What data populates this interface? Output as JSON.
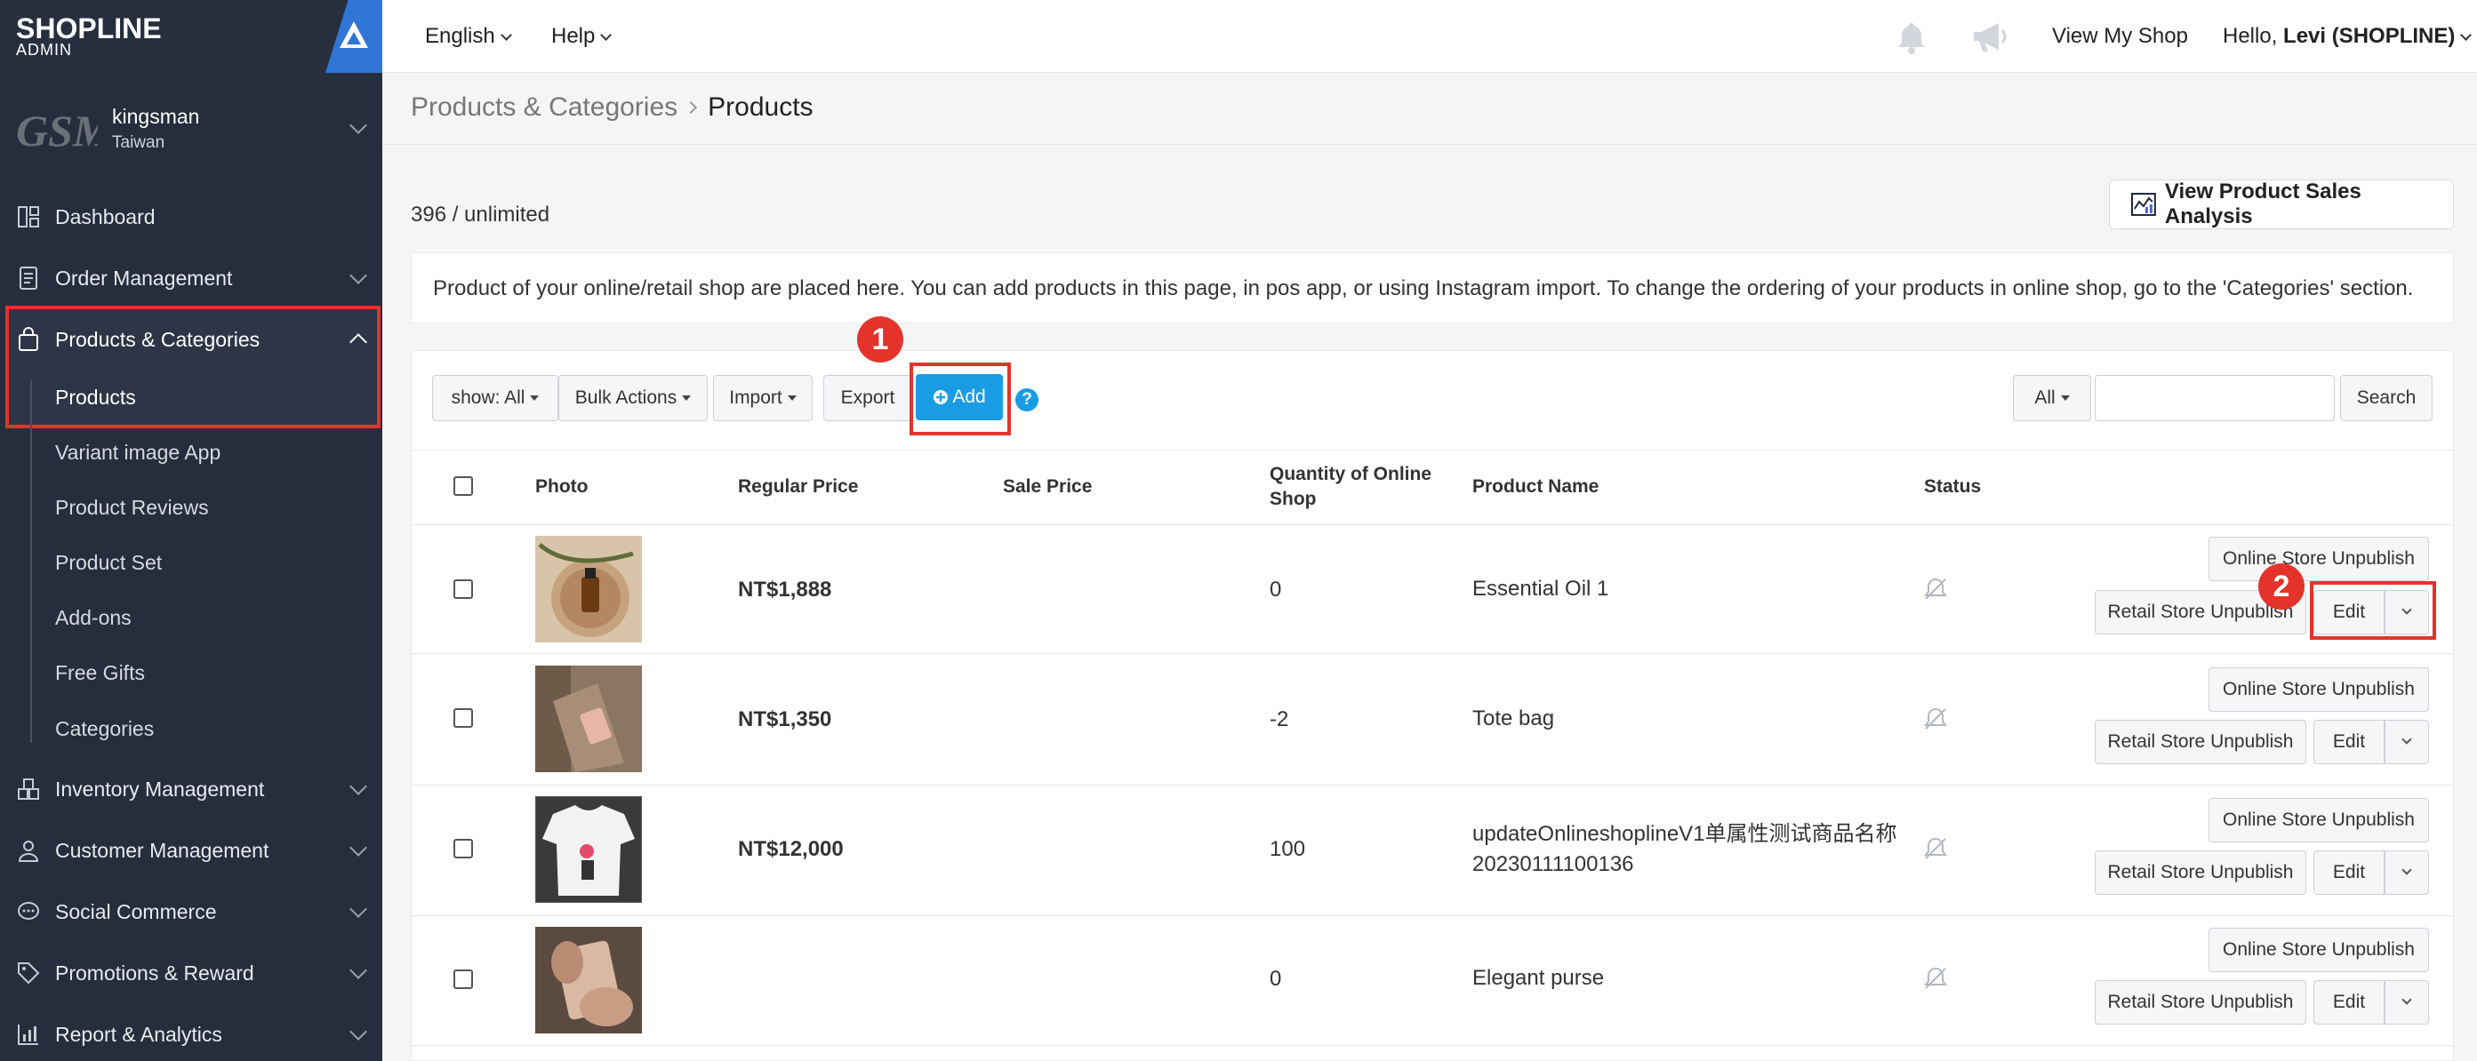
{
  "brand": {
    "logo": "SHOPLINE",
    "sub": "ADMIN"
  },
  "shop": {
    "avatar_text": "GSM",
    "name": "kingsman",
    "region": "Taiwan"
  },
  "sidebar": {
    "items": [
      {
        "label": "Dashboard",
        "icon": "dashboard-icon"
      },
      {
        "label": "Order Management",
        "icon": "order-icon"
      },
      {
        "label": "Products & Categories",
        "icon": "shopping-bag-icon"
      },
      {
        "label": "Inventory Management",
        "icon": "inventory-icon"
      },
      {
        "label": "Customer Management",
        "icon": "customer-icon"
      },
      {
        "label": "Social Commerce",
        "icon": "chat-icon"
      },
      {
        "label": "Promotions & Reward",
        "icon": "tag-icon"
      },
      {
        "label": "Report & Analytics",
        "icon": "chart-icon"
      }
    ],
    "sub_items": [
      "Products",
      "Variant image App",
      "Product Reviews",
      "Product Set",
      "Add-ons",
      "Free Gifts",
      "Categories"
    ]
  },
  "topbar": {
    "language": "English",
    "help": "Help",
    "view_shop": "View My Shop",
    "greeting": "Hello, ",
    "user": "Levi (SHOPLINE)"
  },
  "breadcrumb": {
    "parent": "Products & Categories",
    "current": "Products"
  },
  "count": "396 / unlimited",
  "analysis_button": "View Product Sales Analysis",
  "info_text": "Product of your online/retail shop are placed here. You can add products in this page, in pos app, or using Instagram import. To change the ordering of your products in online shop, go to the 'Categories' section.",
  "toolbar": {
    "show": "show: All",
    "bulk": "Bulk Actions",
    "import": "Import",
    "export": "Export",
    "add": "Add",
    "help": "?",
    "filter": "All",
    "search": "Search",
    "search_value": ""
  },
  "markers": {
    "one": "1",
    "two": "2"
  },
  "table": {
    "headers": {
      "photo": "Photo",
      "regular_price": "Regular Price",
      "sale_price": "Sale Price",
      "qty_line1": "Quantity of Online",
      "qty_line2": "Shop",
      "name": "Product Name",
      "status": "Status"
    },
    "rows": [
      {
        "price": "NT$1,888",
        "qty": "0",
        "name": "Essential Oil 1",
        "name2": ""
      },
      {
        "price": "NT$1,350",
        "qty": "-2",
        "name": "Tote bag",
        "name2": ""
      },
      {
        "price": "NT$12,000",
        "qty": "100",
        "name": "updateOnlineshoplineV1单属性测试商品名称",
        "name2": "20230111100136"
      },
      {
        "price": "",
        "qty": "0",
        "name": "Elegant purse",
        "name2": ""
      }
    ],
    "actions": {
      "online": "Online Store Unpublish",
      "retail": "Retail Store Unpublish",
      "edit": "Edit"
    }
  },
  "colors": {
    "sidebar": "#262e3d",
    "accent": "#1a9ce5",
    "highlight": "#e4332a"
  }
}
